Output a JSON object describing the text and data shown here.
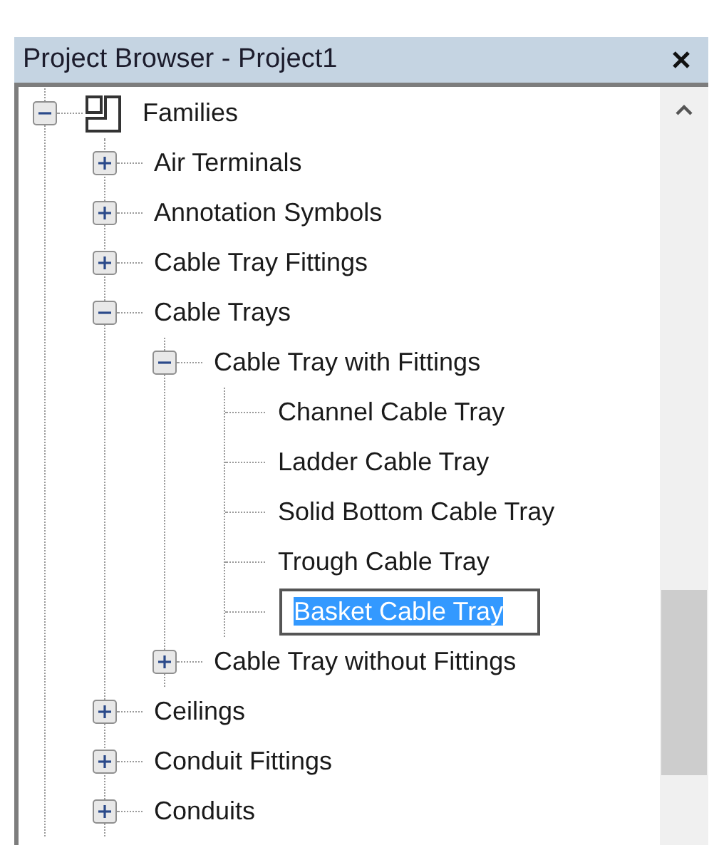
{
  "panel": {
    "title": "Project Browser - Project1"
  },
  "tree": [
    {
      "label": "Families",
      "kind": "folder",
      "expanded": true,
      "selected": false,
      "children": [
        {
          "label": "Air Terminals",
          "kind": "group",
          "expanded": false,
          "selected": false
        },
        {
          "label": "Annotation Symbols",
          "kind": "group",
          "expanded": false,
          "selected": false
        },
        {
          "label": "Cable Tray Fittings",
          "kind": "group",
          "expanded": false,
          "selected": false
        },
        {
          "label": "Cable Trays",
          "kind": "group",
          "expanded": true,
          "selected": false,
          "children": [
            {
              "label": "Cable Tray with Fittings",
              "kind": "group",
              "expanded": true,
              "selected": false,
              "children": [
                {
                  "label": "Channel Cable Tray",
                  "kind": "leaf",
                  "selected": false
                },
                {
                  "label": "Ladder Cable Tray",
                  "kind": "leaf",
                  "selected": false
                },
                {
                  "label": "Solid Bottom Cable Tray",
                  "kind": "leaf",
                  "selected": false
                },
                {
                  "label": "Trough Cable Tray",
                  "kind": "leaf",
                  "selected": false
                },
                {
                  "label": "Basket Cable Tray",
                  "kind": "leaf",
                  "selected": true
                }
              ]
            },
            {
              "label": "Cable Tray without Fittings",
              "kind": "group",
              "expanded": false,
              "selected": false
            }
          ]
        },
        {
          "label": "Ceilings",
          "kind": "group",
          "expanded": false,
          "selected": false
        },
        {
          "label": "Conduit Fittings",
          "kind": "group",
          "expanded": false,
          "selected": false
        },
        {
          "label": "Conduits",
          "kind": "group",
          "expanded": false,
          "selected": false
        }
      ]
    }
  ]
}
